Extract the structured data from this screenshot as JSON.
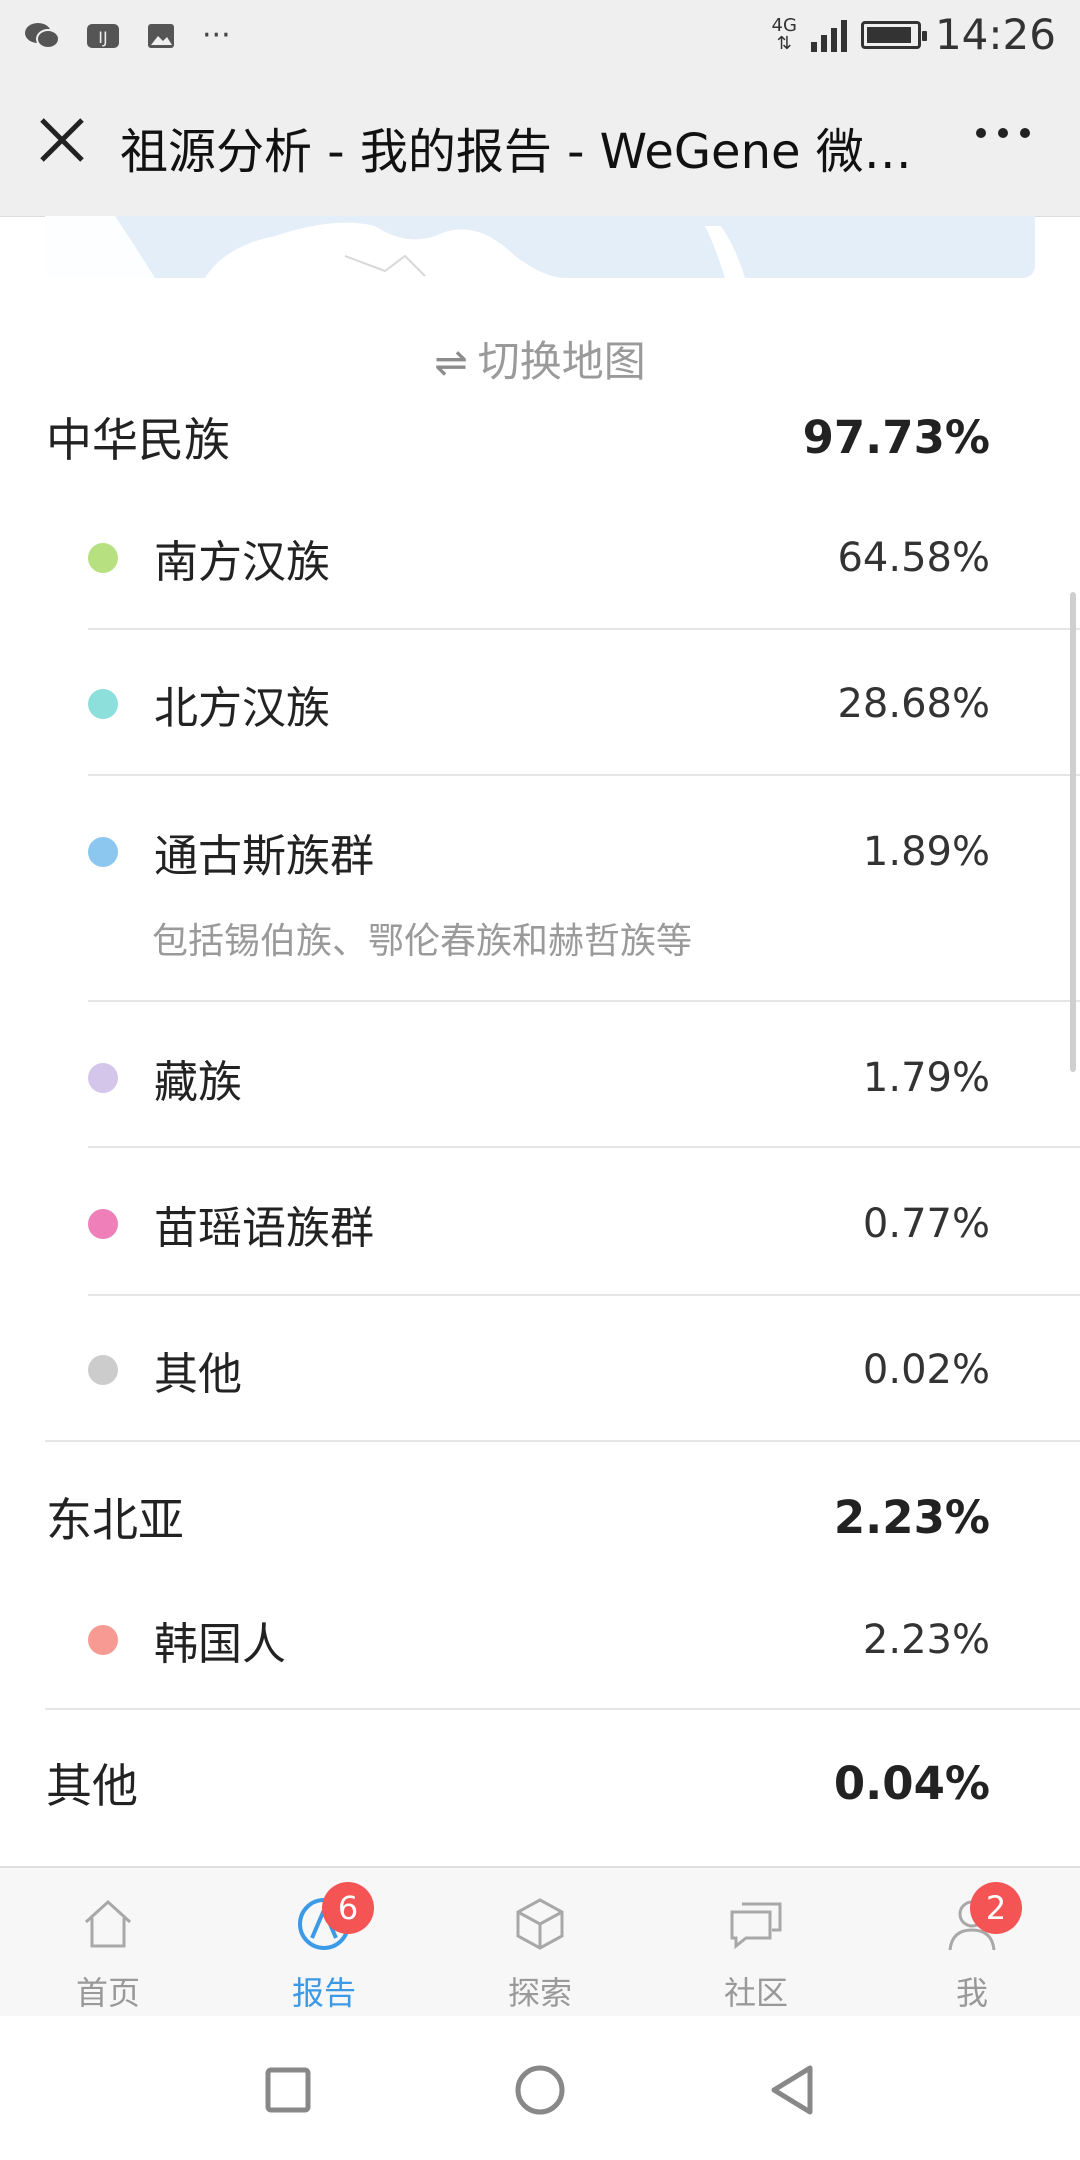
{
  "status_bar": {
    "icons": [
      "wechat-icon",
      "app-icon",
      "image-icon",
      "more-icon"
    ],
    "network": "4G",
    "time": "14:26"
  },
  "title_bar": {
    "title": "祖源分析 - 我的报告 - WeGene 微…"
  },
  "switch_map": {
    "icon": "⇌",
    "label": "切换地图"
  },
  "groups": [
    {
      "name": "中华民族",
      "percent": "97.73%",
      "items": [
        {
          "name": "南方汉族",
          "percent": "64.58%",
          "color": "#b7e080"
        },
        {
          "name": "北方汉族",
          "percent": "28.68%",
          "color": "#8ddfdb"
        },
        {
          "name": "通古斯族群",
          "percent": "1.89%",
          "color": "#8cc7f0",
          "desc": "包括锡伯族、鄂伦春族和赫哲族等"
        },
        {
          "name": "藏族",
          "percent": "1.79%",
          "color": "#d3c6ea"
        },
        {
          "name": "苗瑶语族群",
          "percent": "0.77%",
          "color": "#ee7fb8"
        },
        {
          "name": "其他",
          "percent": "0.02%",
          "color": "#cccccc"
        }
      ]
    },
    {
      "name": "东北亚",
      "percent": "2.23%",
      "items": [
        {
          "name": "韩国人",
          "percent": "2.23%",
          "color": "#f79a94"
        }
      ]
    },
    {
      "name": "其他",
      "percent": "0.04%",
      "items": []
    }
  ],
  "bottom_nav": [
    {
      "label": "首页",
      "icon": "home-icon",
      "active": false,
      "badge": ""
    },
    {
      "label": "报告",
      "icon": "report-icon",
      "active": true,
      "badge": "6"
    },
    {
      "label": "探索",
      "icon": "cube-icon",
      "active": false,
      "badge": ""
    },
    {
      "label": "社区",
      "icon": "chat-icon",
      "active": false,
      "badge": ""
    },
    {
      "label": "我",
      "icon": "user-icon",
      "active": false,
      "badge": "2"
    }
  ],
  "colors": {
    "accent": "#3b9ae8",
    "badge": "#f45454"
  }
}
